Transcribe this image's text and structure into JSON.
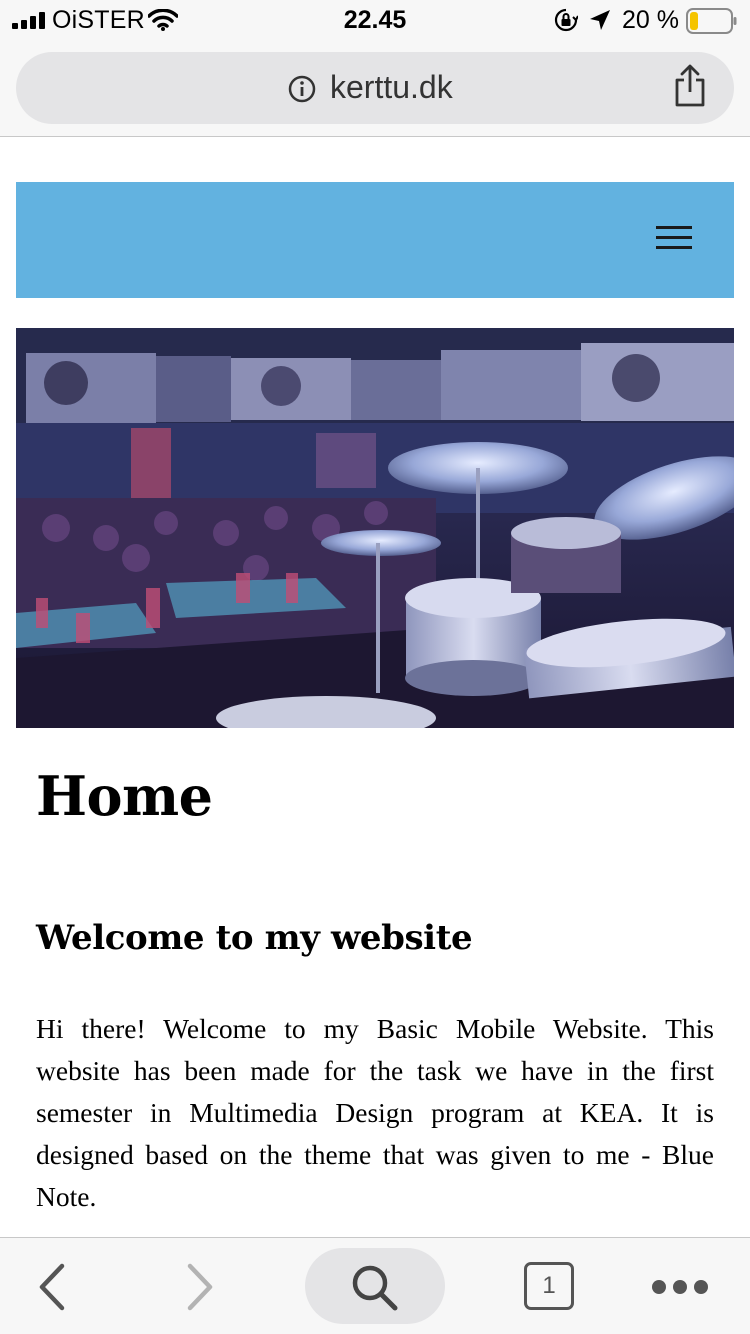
{
  "status_bar": {
    "carrier": "OiSTER",
    "time": "22.45",
    "battery_percent": "20 %",
    "battery_level": 0.2,
    "battery_color": "#f5c400"
  },
  "browser": {
    "url": "kerttu.dk",
    "tab_count": "1",
    "icons": {
      "info": "info-icon",
      "share": "share-icon",
      "back": "back-chevron-icon",
      "forward": "forward-chevron-icon",
      "search": "search-icon",
      "tabs": "tabs-icon",
      "more": "more-dots-icon"
    }
  },
  "site": {
    "header_color": "#62b2e0",
    "menu_icon": "hamburger-menu-icon",
    "hero_image": "jazz-club-drum-kit-photo",
    "page_title": "Home",
    "section_heading": "Welcome to my website",
    "body_text": "Hi there! Welcome to my Basic Mobile Website. This website has been made for the task we have in the first semester in Multimedia Design program at KEA. It is designed based on the theme that was given to me - Blue Note."
  }
}
